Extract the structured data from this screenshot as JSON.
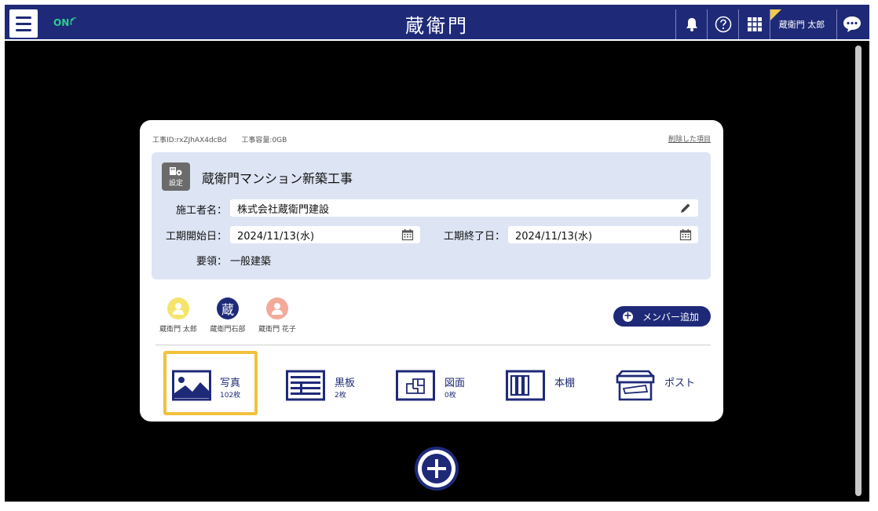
{
  "header": {
    "status": "ON",
    "logo": "蔵衛門",
    "user_name": "蔵衛門 太郎"
  },
  "project": {
    "id_label": "工事ID:rxZJhAX4dcBd",
    "capacity_label": "工事容量:0GB",
    "deleted_link": "削除した項目",
    "settings_label": "設定",
    "title": "蔵衛門マンション新築工事",
    "builder_label": "施工者名：",
    "builder_value": "株式会社蔵衛門建設",
    "start_label": "工期開始日：",
    "start_value": "2024/11/13(水)",
    "end_label": "工期終了日：",
    "end_value": "2024/11/13(水)",
    "summary_label": "要領：",
    "summary_value": "一般建築"
  },
  "members": [
    {
      "name": "蔵衛門 太郎",
      "avatar_color": "#f6e36b"
    },
    {
      "name": "蔵衛門石部",
      "avatar_color": "#1e2a78",
      "avatar_text": "蔵"
    },
    {
      "name": "蔵衛門 花子",
      "avatar_color": "#f4a99a"
    }
  ],
  "add_member_label": "メンバー追加",
  "categories": [
    {
      "name": "写真",
      "count": "102枚",
      "icon": "photo-icon"
    },
    {
      "name": "黒板",
      "count": "2枚",
      "icon": "blackboard-icon"
    },
    {
      "name": "図面",
      "count": "0枚",
      "icon": "drawing-icon"
    },
    {
      "name": "本棚",
      "count": "",
      "icon": "bookshelf-icon"
    },
    {
      "name": "ポスト",
      "count": "",
      "icon": "post-icon"
    }
  ],
  "colors": {
    "navy": "#1e2a78",
    "highlight": "#f2c13c",
    "panel": "#dde5f4",
    "online": "#2ecc8f"
  }
}
